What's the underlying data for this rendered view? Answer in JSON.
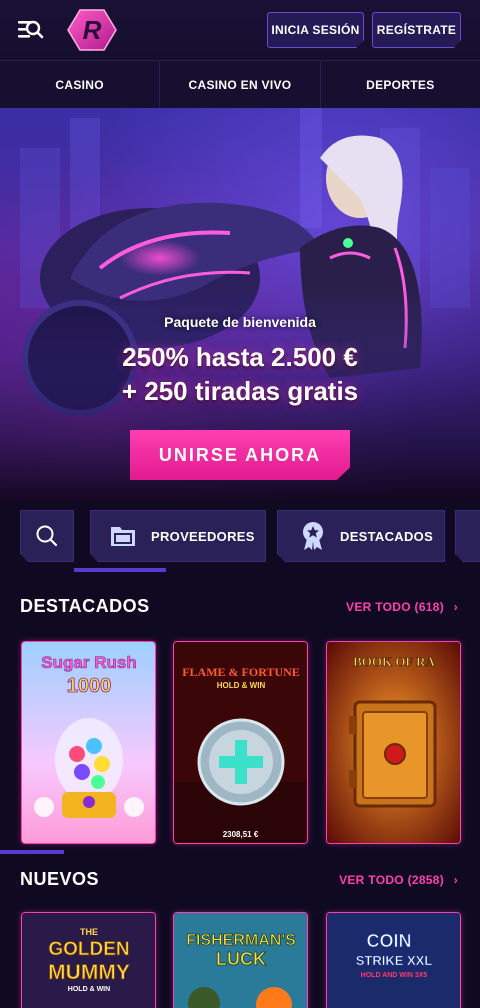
{
  "header": {
    "login_label": "INICIA SESIÓN",
    "register_label": "REGÍSTRATE",
    "logo_letter": "R"
  },
  "nav": {
    "tabs": [
      "CASINO",
      "CASINO EN VIVO",
      "DEPORTES"
    ]
  },
  "hero": {
    "subtitle": "Paquete de bienvenida",
    "title_line1": "250% hasta 2.500 €",
    "title_line2": "+ 250 tiradas gratis",
    "cta_label": "UNIRSE AHORA"
  },
  "categories": {
    "providers_label": "PROVEEDORES",
    "featured_label": "DESTACADOS"
  },
  "featured_section": {
    "title": "DESTACADOS",
    "link": "VER TODO (618)",
    "games": [
      {
        "title_a": "Sugar Rush",
        "title_b": "1000"
      },
      {
        "title_a": "FLAME & FORTUNE",
        "title_b": "HOLD & WIN",
        "prize": "2308,51 €"
      },
      {
        "title_a": "BOOK OF RA"
      }
    ]
  },
  "new_section": {
    "title": "NUEVOS",
    "link": "VER TODO (2858)",
    "games": [
      {
        "title_a": "THE",
        "title_b": "GOLDEN",
        "title_c": "MUMMY",
        "title_d": "HOLD & WIN"
      },
      {
        "title_a": "FISHERMAN'S",
        "title_b": "LUCK"
      },
      {
        "title_a": "COIN",
        "title_b": "STRIKE XXL",
        "title_c": "HOLD AND WIN 3X5"
      }
    ]
  },
  "colors": {
    "accent_pink": "#ff3fb0",
    "panel": "#2a2158",
    "bg": "#0f0a22"
  }
}
